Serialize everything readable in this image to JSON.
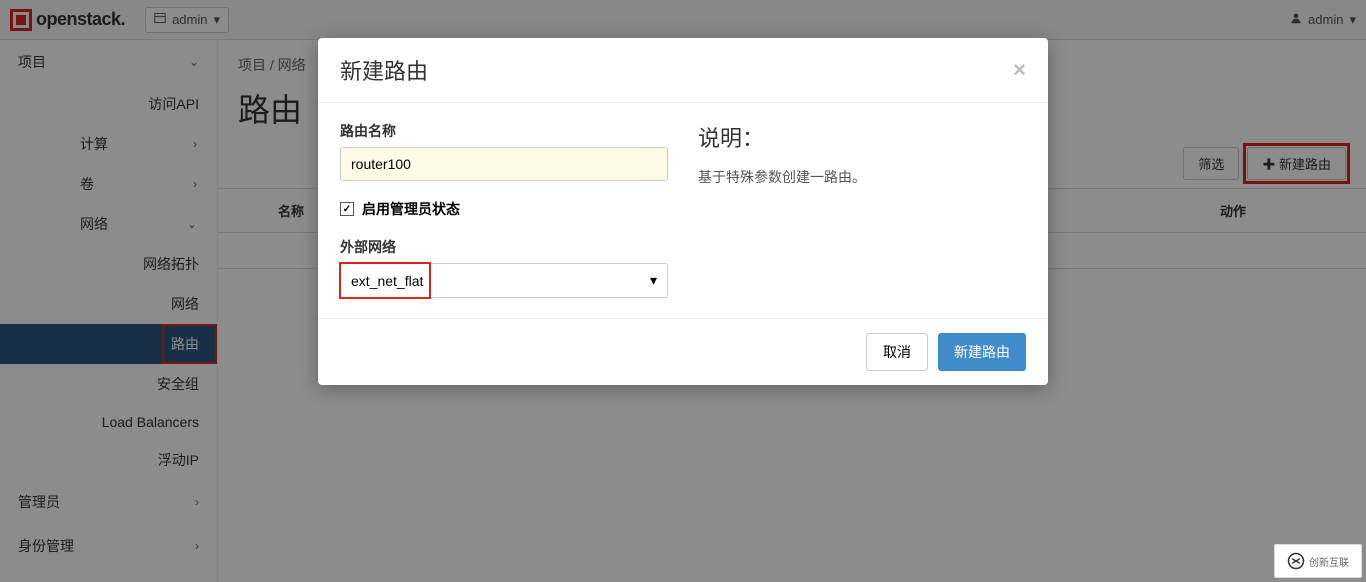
{
  "topbar": {
    "brand": "openstack",
    "brand_suffix": ".",
    "domain_label": "admin",
    "user_label": "admin"
  },
  "sidebar": {
    "project": "项目",
    "access_api": "访问API",
    "compute": "计算",
    "volumes": "卷",
    "network": "网络",
    "network_items": {
      "topology": "网络拓扑",
      "networks": "网络",
      "routers": "路由",
      "secgroups": "安全组",
      "loadbalancers": "Load Balancers",
      "floatingip": "浮动IP"
    },
    "admin": "管理员",
    "identity": "身份管理"
  },
  "content": {
    "breadcrumb_project": "项目",
    "breadcrumb_sep": " / ",
    "breadcrumb_network": "网络",
    "title": "路由",
    "filter_btn": "筛选",
    "create_btn": "新建路由",
    "col_name": "名称",
    "col_action": "动作"
  },
  "modal": {
    "title": "新建路由",
    "label_name": "路由名称",
    "value_name": "router100",
    "label_adminstate": "启用管理员状态",
    "label_extnet": "外部网络",
    "value_extnet": "ext_net_flat",
    "desc_title": "说明：",
    "desc_text": "基于特殊参数创建一路由。",
    "cancel": "取消",
    "submit": "新建路由"
  },
  "watermark": "创新互联"
}
